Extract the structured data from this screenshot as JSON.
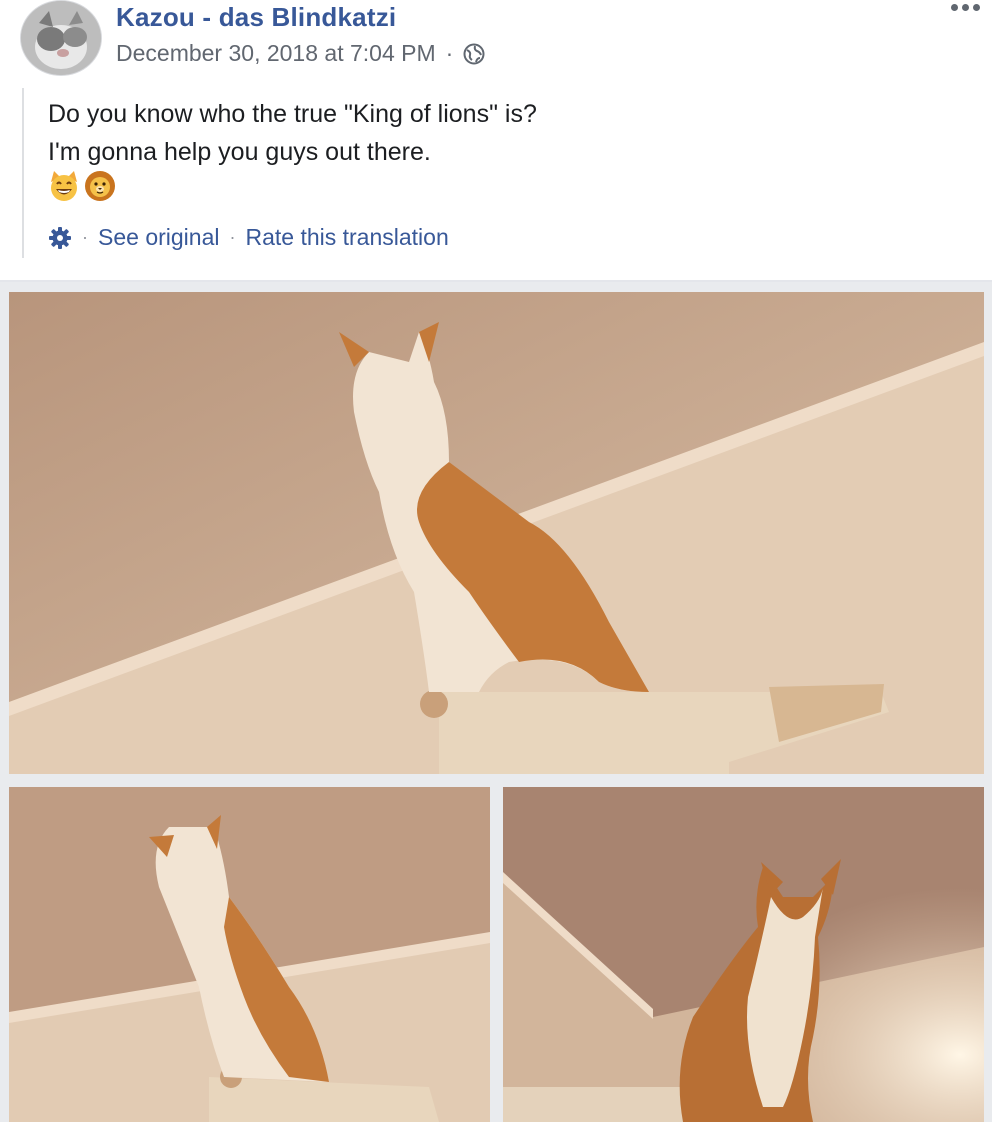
{
  "post": {
    "author": "Kazou - das Blindkatzi",
    "timestamp": "December 30, 2018 at 7:04 PM",
    "separator": "·",
    "privacy_icon": "globe-icon",
    "more_icon": "more-options-icon",
    "text_lines": [
      "Do you know who the true \"King of lions\" is?",
      "I'm gonna help you guys out there."
    ],
    "emojis": [
      "grinning-cat-icon",
      "lion-face-icon"
    ],
    "translation": {
      "settings_icon": "gear-icon",
      "see_original": "See original",
      "rate_translation": "Rate this translation"
    }
  },
  "colors": {
    "link": "#385898",
    "meta_text": "#616770",
    "body_text": "#1c1e21",
    "photo_bg": "#e9ebee"
  }
}
